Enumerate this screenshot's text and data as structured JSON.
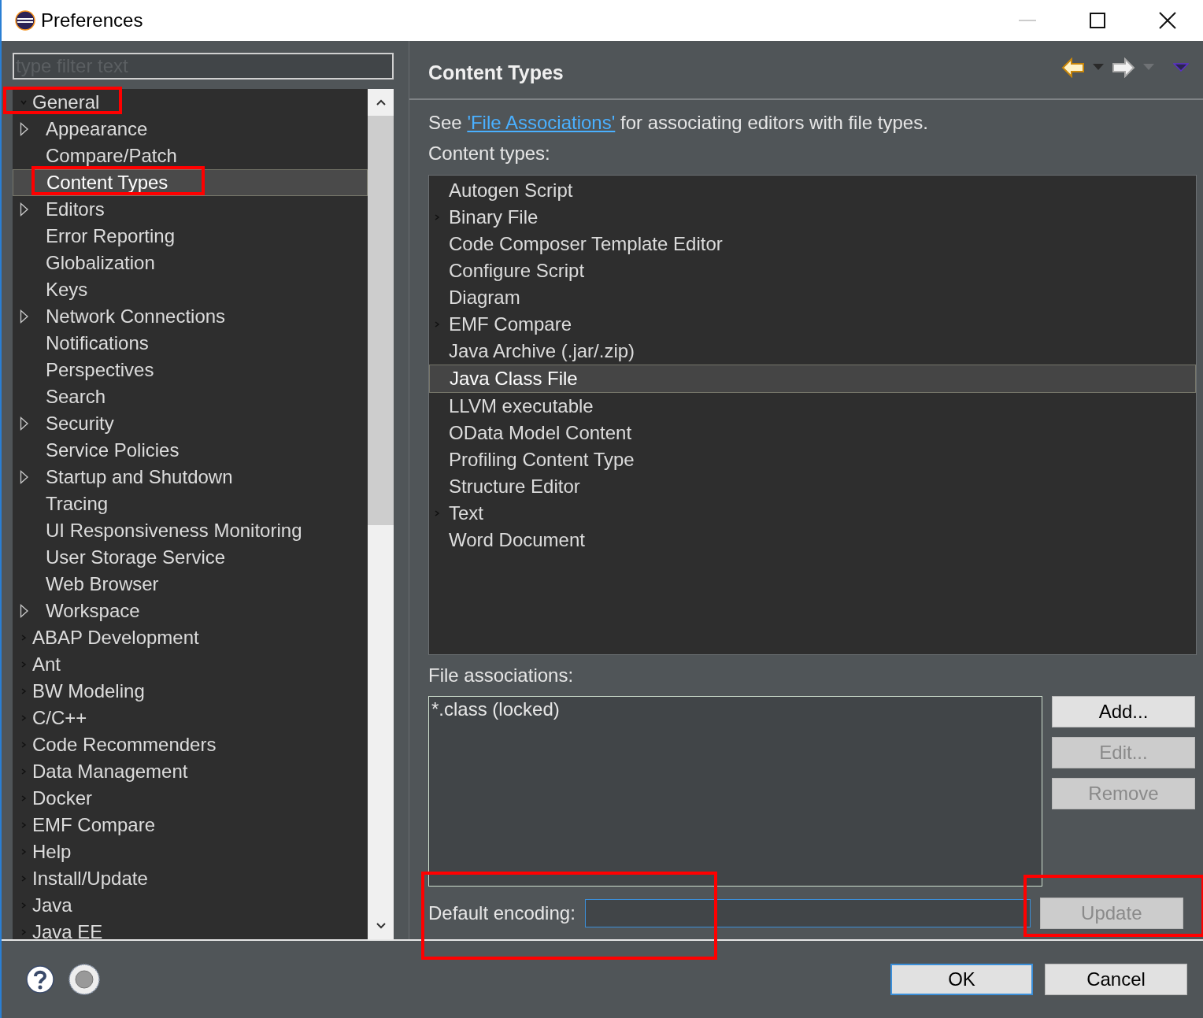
{
  "window": {
    "title": "Preferences"
  },
  "filter": {
    "placeholder": "type filter text"
  },
  "tree": [
    {
      "label": "General",
      "expanded": true,
      "selected": false,
      "children": [
        {
          "label": "Appearance",
          "expandable": true,
          "selected": false
        },
        {
          "label": "Compare/Patch",
          "expandable": false,
          "selected": false
        },
        {
          "label": "Content Types",
          "expandable": false,
          "selected": true
        },
        {
          "label": "Editors",
          "expandable": true,
          "selected": false
        },
        {
          "label": "Error Reporting",
          "expandable": false,
          "selected": false
        },
        {
          "label": "Globalization",
          "expandable": false,
          "selected": false
        },
        {
          "label": "Keys",
          "expandable": false,
          "selected": false
        },
        {
          "label": "Network Connections",
          "expandable": true,
          "selected": false
        },
        {
          "label": "Notifications",
          "expandable": false,
          "selected": false
        },
        {
          "label": "Perspectives",
          "expandable": false,
          "selected": false
        },
        {
          "label": "Search",
          "expandable": false,
          "selected": false
        },
        {
          "label": "Security",
          "expandable": true,
          "selected": false
        },
        {
          "label": "Service Policies",
          "expandable": false,
          "selected": false
        },
        {
          "label": "Startup and Shutdown",
          "expandable": true,
          "selected": false
        },
        {
          "label": "Tracing",
          "expandable": false,
          "selected": false
        },
        {
          "label": "UI Responsiveness Monitoring",
          "expandable": false,
          "selected": false
        },
        {
          "label": "User Storage Service",
          "expandable": false,
          "selected": false
        },
        {
          "label": "Web Browser",
          "expandable": false,
          "selected": false
        },
        {
          "label": "Workspace",
          "expandable": true,
          "selected": false
        }
      ]
    },
    {
      "label": "ABAP Development",
      "expanded": false,
      "selected": false
    },
    {
      "label": "Ant",
      "expanded": false,
      "selected": false
    },
    {
      "label": "BW Modeling",
      "expanded": false,
      "selected": false
    },
    {
      "label": "C/C++",
      "expanded": false,
      "selected": false
    },
    {
      "label": "Code Recommenders",
      "expanded": false,
      "selected": false
    },
    {
      "label": "Data Management",
      "expanded": false,
      "selected": false
    },
    {
      "label": "Docker",
      "expanded": false,
      "selected": false
    },
    {
      "label": "EMF Compare",
      "expanded": false,
      "selected": false
    },
    {
      "label": "Help",
      "expanded": false,
      "selected": false
    },
    {
      "label": "Install/Update",
      "expanded": false,
      "selected": false
    },
    {
      "label": "Java",
      "expanded": false,
      "selected": false
    },
    {
      "label": "Java EE",
      "expanded": false,
      "selected": false
    }
  ],
  "page": {
    "title": "Content Types",
    "intro_before": "See ",
    "intro_link": "'File Associations'",
    "intro_after": " for associating editors with file types.",
    "content_types_label": "Content types:",
    "content_types": [
      {
        "label": "Autogen Script",
        "expandable": false,
        "selected": false
      },
      {
        "label": "Binary File",
        "expandable": true,
        "selected": false
      },
      {
        "label": "Code Composer Template Editor",
        "expandable": false,
        "selected": false
      },
      {
        "label": "Configure Script",
        "expandable": false,
        "selected": false
      },
      {
        "label": "Diagram",
        "expandable": false,
        "selected": false
      },
      {
        "label": "EMF Compare",
        "expandable": true,
        "selected": false
      },
      {
        "label": "Java Archive (.jar/.zip)",
        "expandable": false,
        "selected": false
      },
      {
        "label": "Java Class File",
        "expandable": false,
        "selected": true
      },
      {
        "label": "LLVM executable",
        "expandable": false,
        "selected": false
      },
      {
        "label": "OData Model Content",
        "expandable": false,
        "selected": false
      },
      {
        "label": "Profiling Content Type",
        "expandable": false,
        "selected": false
      },
      {
        "label": "Structure Editor",
        "expandable": false,
        "selected": false
      },
      {
        "label": "Text",
        "expandable": true,
        "selected": false
      },
      {
        "label": "Word Document",
        "expandable": false,
        "selected": false
      }
    ],
    "file_associations_label": "File associations:",
    "file_associations": [
      "*.class (locked)"
    ],
    "association_buttons": [
      {
        "label": "Add...",
        "disabled": false
      },
      {
        "label": "Edit...",
        "disabled": true
      },
      {
        "label": "Remove",
        "disabled": true
      }
    ],
    "default_encoding_label": "Default encoding:",
    "update_button": {
      "label": "Update",
      "disabled": true
    }
  },
  "footer_buttons": [
    {
      "label": "OK",
      "default": true
    },
    {
      "label": "Cancel",
      "default": false
    }
  ]
}
